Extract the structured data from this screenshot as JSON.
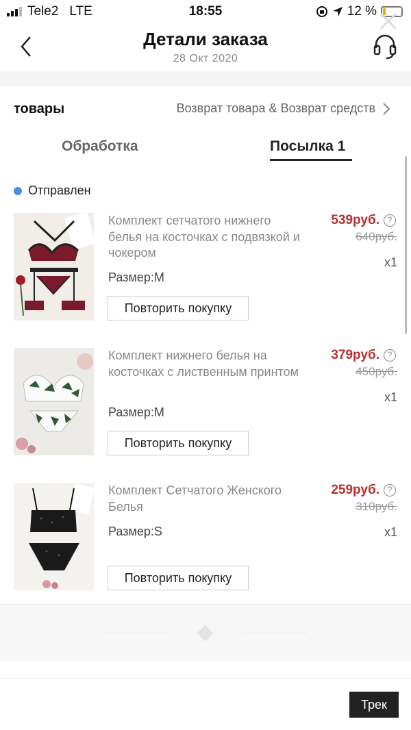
{
  "status_bar": {
    "carrier": "Tele2",
    "network": "LTE",
    "time": "18:55",
    "battery": "12 %"
  },
  "header": {
    "title": "Детали заказа",
    "date": "28 Окт 2020"
  },
  "goods": {
    "title": "товары",
    "returns_link": "Возврат товара & Возврат средств"
  },
  "tabs": [
    {
      "label": "Обработка",
      "active": false
    },
    {
      "label": "Посылка 1",
      "active": true
    }
  ],
  "shipment_status": "Отправлен",
  "products": [
    {
      "name": "Комплект сетчатого нижнего белья на косточках с подвязкой и чокером",
      "size": "Размер:M",
      "price": "539руб.",
      "old_price": "640руб.",
      "qty": "x1",
      "rebuy_label": "Повторить покупку"
    },
    {
      "name": "Комплект нижнего белья на косточках с лиственным принтом",
      "size": "Размер:M",
      "price": "379руб.",
      "old_price": "450руб.",
      "qty": "x1",
      "rebuy_label": "Повторить покупку"
    },
    {
      "name": "Комплект Сетчатого Женского Белья",
      "size": "Размер:S",
      "price": "259руб.",
      "old_price": "310руб.",
      "qty": "x1",
      "rebuy_label": "Повторить покупку"
    }
  ],
  "footer": {
    "track_label": "Трек"
  },
  "colors": {
    "price": "#b8312f",
    "status_dot": "#4a8ee0",
    "button_dark": "#222222"
  }
}
